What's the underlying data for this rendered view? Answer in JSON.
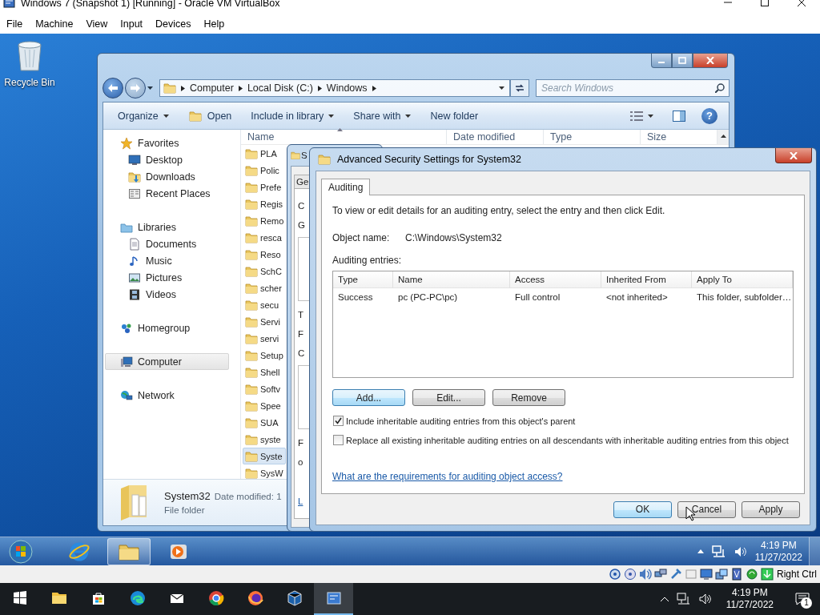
{
  "host_window": {
    "title": "Windows 7 (Snapshot 1) [Running] - Oracle VM VirtualBox"
  },
  "menu_bar": [
    "File",
    "Machine",
    "View",
    "Input",
    "Devices",
    "Help"
  ],
  "desktop_icons": [
    {
      "label": "Recycle Bin"
    }
  ],
  "explorer": {
    "breadcrumb": [
      "Computer",
      "Local Disk (C:)",
      "Windows"
    ],
    "search": {
      "placeholder": "Search Windows"
    },
    "toolbar": [
      {
        "label": "Organize",
        "kind": "menu"
      },
      {
        "label": "Open",
        "kind": "open"
      },
      {
        "label": "Include in library",
        "kind": "menu"
      },
      {
        "label": "Share with",
        "kind": "menu"
      },
      {
        "label": "New folder",
        "kind": "plain"
      }
    ],
    "help": "?",
    "nav": [
      {
        "label": "Favorites",
        "kind": "favorites",
        "selected": false,
        "children": [
          {
            "label": "Desktop",
            "kind": "desktop",
            "selected": false
          },
          {
            "label": "Downloads",
            "kind": "downloads",
            "selected": false
          },
          {
            "label": "Recent Places",
            "kind": "recent",
            "selected": false
          }
        ]
      },
      {
        "label": "Libraries",
        "kind": "libraries",
        "selected": false,
        "children": [
          {
            "label": "Documents",
            "kind": "documents",
            "selected": false
          },
          {
            "label": "Music",
            "kind": "music",
            "selected": false
          },
          {
            "label": "Pictures",
            "kind": "pictures",
            "selected": false
          },
          {
            "label": "Videos",
            "kind": "videos",
            "selected": false
          }
        ]
      },
      {
        "label": "Homegroup",
        "kind": "homegroup",
        "selected": false
      },
      {
        "label": "Computer",
        "kind": "computer",
        "selected": true
      },
      {
        "label": "Network",
        "kind": "network",
        "selected": false
      }
    ],
    "columns": [
      "Name",
      "Date modified",
      "Type",
      "Size"
    ],
    "files": [
      {
        "name": "PLA",
        "selected": false
      },
      {
        "name": "Polic",
        "selected": false
      },
      {
        "name": "Prefe",
        "selected": false
      },
      {
        "name": "Regis",
        "selected": false
      },
      {
        "name": "Remo",
        "selected": false
      },
      {
        "name": "resca",
        "selected": false
      },
      {
        "name": "Reso",
        "selected": false
      },
      {
        "name": "SchC",
        "selected": false
      },
      {
        "name": "scher",
        "selected": false
      },
      {
        "name": "secu",
        "selected": false
      },
      {
        "name": "Servi",
        "selected": false
      },
      {
        "name": "servi",
        "selected": false
      },
      {
        "name": "Setup",
        "selected": false
      },
      {
        "name": "Shell",
        "selected": false
      },
      {
        "name": "Softv",
        "selected": false
      },
      {
        "name": "Spee",
        "selected": false
      },
      {
        "name": "SUA",
        "selected": false
      },
      {
        "name": "syste",
        "selected": false
      },
      {
        "name": "Syste",
        "selected": true
      },
      {
        "name": "SysW",
        "selected": false
      }
    ],
    "details": {
      "name": "System32",
      "meta": "Date modified: 1",
      "type": "File folder"
    }
  },
  "properties_dialog": {
    "title": "S",
    "tab": "Ge",
    "fragments": [
      {
        "text": "C",
        "kind": "line"
      },
      {
        "text": "G",
        "kind": "group"
      },
      {
        "text": "T",
        "kind": "line"
      },
      {
        "text": "F",
        "kind": "line"
      },
      {
        "text": "C",
        "kind": "group"
      },
      {
        "text": "F",
        "kind": "line"
      },
      {
        "text": "o",
        "kind": "line"
      }
    ],
    "link": "L"
  },
  "security_dialog": {
    "title": "Advanced Security Settings for System32",
    "tabs": [
      {
        "label": "Auditing",
        "selected": true
      }
    ],
    "instruction": "To view or edit details for an auditing entry, select the entry and then click Edit.",
    "object_name_label": "Object name:",
    "object_name": "C:\\Windows\\System32",
    "entries_label": "Auditing entries:",
    "columns": [
      "Type",
      "Name",
      "Access",
      "Inherited From",
      "Apply To"
    ],
    "rows": [
      [
        "Success",
        "pc (PC-PC\\pc)",
        "Full control",
        "<not inherited>",
        "This folder, subfolder…"
      ]
    ],
    "buttons": [
      {
        "label": "Add...",
        "focused": true
      },
      {
        "label": "Edit...",
        "focused": false
      },
      {
        "label": "Remove",
        "focused": false
      }
    ],
    "checkboxes": [
      {
        "label": "Include inheritable auditing entries from this object's parent",
        "checked": true
      },
      {
        "label": "Replace all existing inheritable auditing entries on all descendants with inheritable auditing entries from this object",
        "checked": false
      }
    ],
    "link": "What are the requirements for auditing object access?",
    "footer_buttons": [
      {
        "label": "OK",
        "focused": true
      },
      {
        "label": "Cancel",
        "focused": false
      },
      {
        "label": "Apply",
        "focused": false
      }
    ]
  },
  "guest_taskbar": {
    "items": [
      {
        "kind": "browser",
        "active": false
      },
      {
        "kind": "explorer",
        "active": true
      },
      {
        "kind": "media",
        "active": false
      }
    ],
    "time": "4:19 PM",
    "date": "11/27/2022"
  },
  "vbox_status": {
    "host_key": "Right Ctrl"
  },
  "host_taskbar": {
    "items": [
      {
        "kind": "start",
        "active": false
      },
      {
        "kind": "explorer",
        "active": false
      },
      {
        "kind": "store",
        "active": false
      },
      {
        "kind": "edge",
        "active": false
      },
      {
        "kind": "mail",
        "active": false
      },
      {
        "kind": "chrome",
        "active": false
      },
      {
        "kind": "firefox",
        "active": false
      },
      {
        "kind": "vbox",
        "active": false
      },
      {
        "kind": "vm",
        "active": true
      }
    ],
    "time": "4:19 PM",
    "date": "11/27/2022",
    "notifications": "1"
  }
}
